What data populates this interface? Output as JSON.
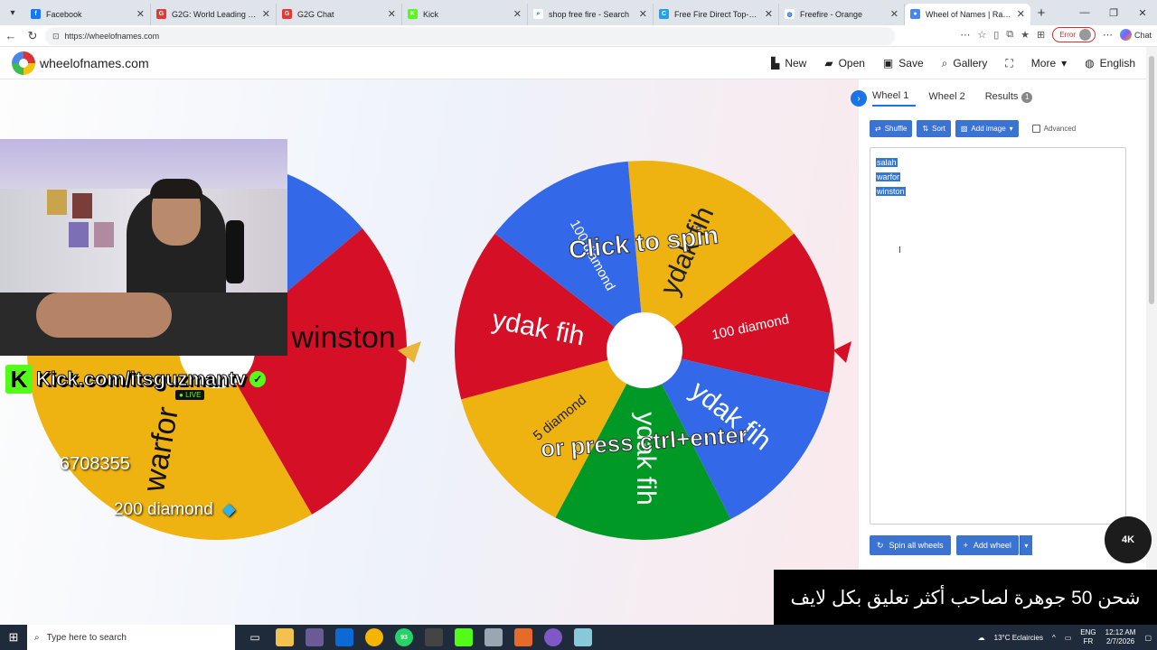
{
  "browser": {
    "tabs": [
      {
        "title": "Facebook",
        "icon": "facebook-icon",
        "color": "#1877f2",
        "glyph": "f"
      },
      {
        "title": "G2G: World Leading Digital Marketplace",
        "icon": "g2g-icon",
        "color": "#e53935",
        "glyph": "G"
      },
      {
        "title": "G2G Chat",
        "icon": "g2g-icon",
        "color": "#e53935",
        "glyph": "G"
      },
      {
        "title": "Kick",
        "icon": "kick-icon",
        "color": "#53fc18",
        "glyph": "K"
      },
      {
        "title": "shop free fire - Search",
        "icon": "search-icon",
        "color": "#ffffff",
        "glyph": "⌕"
      },
      {
        "title": "Free Fire Direct Top-Up | Instant",
        "icon": "topup-icon",
        "color": "#1da1f2",
        "glyph": "C"
      },
      {
        "title": "Freefire - Orange",
        "icon": "globe-icon",
        "color": "#ffffff",
        "glyph": "◍"
      },
      {
        "title": "Wheel of Names | Random name picker",
        "icon": "wheel-icon",
        "color": "#4885ed",
        "glyph": "●"
      }
    ],
    "url": "https://wheelofnames.com",
    "error_label": "Error",
    "copilot_label": "Chat"
  },
  "site": {
    "name": "wheelofnames.com",
    "menu": {
      "new": "New",
      "open": "Open",
      "save": "Save",
      "gallery": "Gallery",
      "more": "More",
      "language": "English"
    }
  },
  "wheel1": {
    "entries": [
      "salah",
      "warfor",
      "winston"
    ],
    "colors": [
      "#3369e8",
      "#d50f25",
      "#eeb211"
    ]
  },
  "wheel2": {
    "labels": [
      "ydak fih",
      "100 diamond",
      "ydak fih",
      "ydak fih",
      "5 diamond",
      "ydak fih",
      "100 diamond"
    ],
    "center_text_1": "Click to spin",
    "center_text_2": "or press ctrl+enter",
    "colors": [
      "#eeb211",
      "#d50f25",
      "#3369e8",
      "#009925"
    ]
  },
  "panel": {
    "tabs": [
      "Wheel 1",
      "Wheel 2",
      "Results"
    ],
    "results_count": "1",
    "buttons": {
      "shuffle": "Shuffle",
      "sort": "Sort",
      "add_image": "Add image",
      "advanced": "Advanced"
    },
    "entries": [
      "salah",
      "warfor",
      "winston"
    ],
    "bottom": {
      "spin_all": "Spin all wheels",
      "add_wheel": "Add wheel"
    }
  },
  "stream": {
    "kick_url": "Kick.com/itsguzmantv",
    "live_label": "LIVE",
    "overlay_number": "6708355",
    "overlay_price": "200 diamond",
    "banner_text": "شحن 50 جوهرة لصاحب أكثر تعليق بكل لايف",
    "logo_text": "4K"
  },
  "taskbar": {
    "search_placeholder": "Type here to search",
    "weather": "13°C  Eclaircies",
    "lang_top": "ENG",
    "lang_bottom": "FR",
    "time": "12:12 AM",
    "date": "2/7/2026",
    "badge": "93"
  }
}
